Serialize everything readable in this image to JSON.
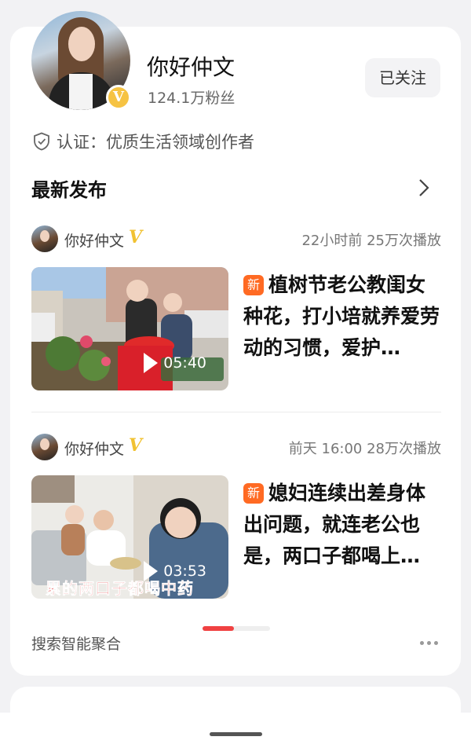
{
  "profile": {
    "name": "你好仲文",
    "fans": "124.1万粉丝",
    "follow_label": "已关注",
    "verify_text": "认证：优质生活领域创作者",
    "badge": "V"
  },
  "section": {
    "title": "最新发布"
  },
  "posts": [
    {
      "author": "你好仲文",
      "author_badge": "V",
      "time_views": "22小时前  25万次播放",
      "duration": "05:40",
      "tag": "新",
      "title": "植树节老公教闺女种花，打小培就养爱劳动的习惯，爱护…"
    },
    {
      "author": "你好仲文",
      "author_badge": "V",
      "time_views": "前天 16:00  28万次播放",
      "duration": "03:53",
      "tag": "新",
      "title": "媳妇连续出差身体出问题，就连老公也是，两口子都喝上…",
      "thumb_caption": "累的两口子都喝中药"
    }
  ],
  "footer": {
    "aggregate_label": "搜索智能聚合"
  },
  "colors": {
    "accent_red": "#f04142",
    "tag_orange": "#ff6a23",
    "verify_gold": "#f6c343"
  }
}
